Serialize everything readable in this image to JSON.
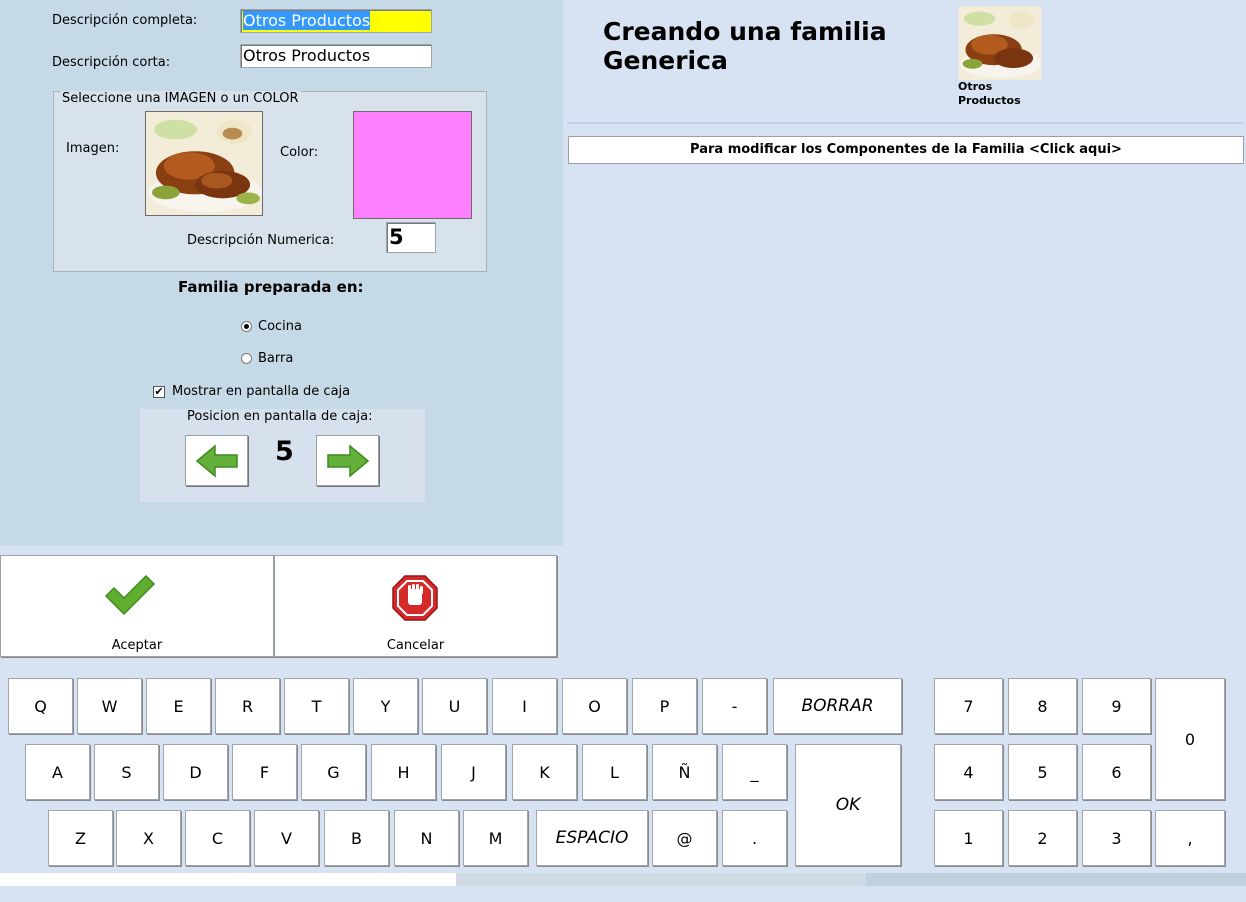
{
  "form": {
    "full_desc_label": "Descripción completa:",
    "full_desc_value": "Otros Productos",
    "short_desc_label": "Descripción corta:",
    "short_desc_value": "Otros Productos",
    "media_group_legend": "Seleccione una IMAGEN o un COLOR",
    "image_label": "Imagen:",
    "color_label": "Color:",
    "color_value": "#ff80ff",
    "numeric_desc_label": "Descripción Numerica:",
    "numeric_desc_value": "5",
    "prepared_in_label": "Familia preparada en:",
    "options": [
      {
        "label": "Cocina",
        "selected": true
      },
      {
        "label": "Barra",
        "selected": false
      }
    ],
    "show_in_cashier_label": "Mostrar en pantalla de caja",
    "show_in_cashier_checked": true,
    "position_label": "Posicion en pantalla de caja:",
    "position_value": "5"
  },
  "actions": {
    "accept_label": "Aceptar",
    "cancel_label": "Cancelar"
  },
  "header": {
    "title": "Creando una familia Generica",
    "thumb_caption": "Otros Productos",
    "modify_bar": "Para modificar los Componentes de la Familia <Click aqui>"
  },
  "keyboard": {
    "row1": [
      "Q",
      "W",
      "E",
      "R",
      "T",
      "Y",
      "U",
      "I",
      "O",
      "P",
      "-"
    ],
    "row2": [
      "A",
      "S",
      "D",
      "F",
      "G",
      "H",
      "J",
      "K",
      "L",
      "Ñ",
      "_"
    ],
    "row3": [
      "Z",
      "X",
      "C",
      "V",
      "B",
      "N",
      "M"
    ],
    "space_label": "ESPACIO",
    "row3_extra": [
      "@",
      "."
    ],
    "delete_label": "BORRAR",
    "ok_label": "OK",
    "numpad": [
      "7",
      "8",
      "9",
      "4",
      "5",
      "6",
      "1",
      "2",
      "3"
    ],
    "zero": "0",
    "comma": ","
  },
  "colors": {
    "panel": "#c6d9e6",
    "background": "#d7e3f3",
    "highlight_input": "#ffff00",
    "accept_green": "#5fae2e",
    "cancel_red": "#d42a2a"
  },
  "icons": {
    "accept": "checkmark-icon",
    "cancel": "stop-hand-icon",
    "prev": "arrow-left-icon",
    "next": "arrow-right-icon"
  }
}
